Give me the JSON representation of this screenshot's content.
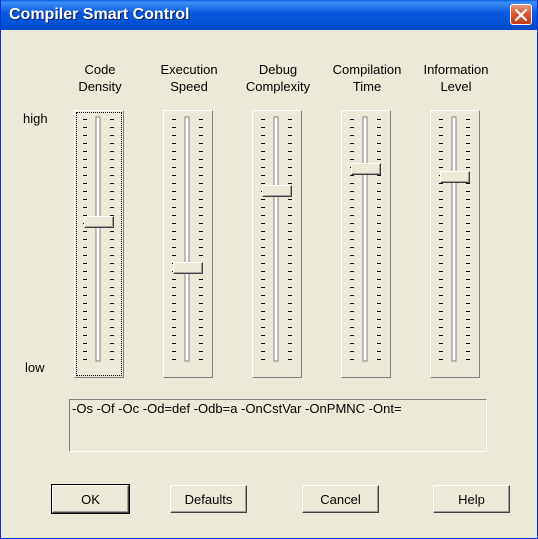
{
  "window": {
    "title": "Compiler Smart Control",
    "close_icon": "close-icon"
  },
  "scale": {
    "high_label": "high",
    "low_label": "low"
  },
  "sliders": [
    {
      "label_line1": "Code",
      "label_line2": "Density",
      "level": 0.57,
      "focused": true
    },
    {
      "label_line1": "Execution",
      "label_line2": "Speed",
      "level": 0.38,
      "focused": false
    },
    {
      "label_line1": "Debug",
      "label_line2": "Complexity",
      "level": 0.7,
      "focused": false
    },
    {
      "label_line1": "Compilation",
      "label_line2": "Time",
      "level": 0.79,
      "focused": false
    },
    {
      "label_line1": "Information",
      "label_line2": "Level",
      "level": 0.76,
      "focused": false
    }
  ],
  "options_text": "-Os -Of -Oc -Od=def -Odb=a -OnCstVar -OnPMNC -Ont=",
  "buttons": {
    "ok": "OK",
    "defaults": "Defaults",
    "cancel": "Cancel",
    "help": "Help"
  },
  "colors": {
    "titlebar": "#0554d8",
    "face": "#ece9d8",
    "close": "#d9572f"
  }
}
